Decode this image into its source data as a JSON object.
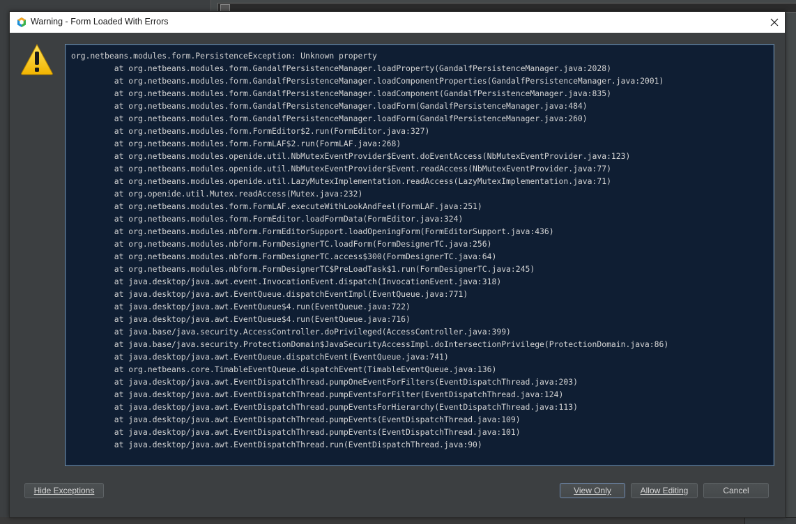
{
  "dialog": {
    "title": "Warning - Form Loaded With Errors"
  },
  "trace": {
    "lines": [
      "org.netbeans.modules.form.PersistenceException: Unknown property",
      "\tat org.netbeans.modules.form.GandalfPersistenceManager.loadProperty(GandalfPersistenceManager.java:2028)",
      "\tat org.netbeans.modules.form.GandalfPersistenceManager.loadComponentProperties(GandalfPersistenceManager.java:2001)",
      "\tat org.netbeans.modules.form.GandalfPersistenceManager.loadComponent(GandalfPersistenceManager.java:835)",
      "\tat org.netbeans.modules.form.GandalfPersistenceManager.loadForm(GandalfPersistenceManager.java:484)",
      "\tat org.netbeans.modules.form.GandalfPersistenceManager.loadForm(GandalfPersistenceManager.java:260)",
      "\tat org.netbeans.modules.form.FormEditor$2.run(FormEditor.java:327)",
      "\tat org.netbeans.modules.form.FormLAF$2.run(FormLAF.java:268)",
      "\tat org.netbeans.modules.openide.util.NbMutexEventProvider$Event.doEventAccess(NbMutexEventProvider.java:123)",
      "\tat org.netbeans.modules.openide.util.NbMutexEventProvider$Event.readAccess(NbMutexEventProvider.java:77)",
      "\tat org.netbeans.modules.openide.util.LazyMutexImplementation.readAccess(LazyMutexImplementation.java:71)",
      "\tat org.openide.util.Mutex.readAccess(Mutex.java:232)",
      "\tat org.netbeans.modules.form.FormLAF.executeWithLookAndFeel(FormLAF.java:251)",
      "\tat org.netbeans.modules.form.FormEditor.loadFormData(FormEditor.java:324)",
      "\tat org.netbeans.modules.nbform.FormEditorSupport.loadOpeningForm(FormEditorSupport.java:436)",
      "\tat org.netbeans.modules.nbform.FormDesignerTC.loadForm(FormDesignerTC.java:256)",
      "\tat org.netbeans.modules.nbform.FormDesignerTC.access$300(FormDesignerTC.java:64)",
      "\tat org.netbeans.modules.nbform.FormDesignerTC$PreLoadTask$1.run(FormDesignerTC.java:245)",
      "\tat java.desktop/java.awt.event.InvocationEvent.dispatch(InvocationEvent.java:318)",
      "\tat java.desktop/java.awt.EventQueue.dispatchEventImpl(EventQueue.java:771)",
      "\tat java.desktop/java.awt.EventQueue$4.run(EventQueue.java:722)",
      "\tat java.desktop/java.awt.EventQueue$4.run(EventQueue.java:716)",
      "\tat java.base/java.security.AccessController.doPrivileged(AccessController.java:399)",
      "\tat java.base/java.security.ProtectionDomain$JavaSecurityAccessImpl.doIntersectionPrivilege(ProtectionDomain.java:86)",
      "\tat java.desktop/java.awt.EventQueue.dispatchEvent(EventQueue.java:741)",
      "\tat org.netbeans.core.TimableEventQueue.dispatchEvent(TimableEventQueue.java:136)",
      "\tat java.desktop/java.awt.EventDispatchThread.pumpOneEventForFilters(EventDispatchThread.java:203)",
      "\tat java.desktop/java.awt.EventDispatchThread.pumpEventsForFilter(EventDispatchThread.java:124)",
      "\tat java.desktop/java.awt.EventDispatchThread.pumpEventsForHierarchy(EventDispatchThread.java:113)",
      "\tat java.desktop/java.awt.EventDispatchThread.pumpEvents(EventDispatchThread.java:109)",
      "\tat java.desktop/java.awt.EventDispatchThread.pumpEvents(EventDispatchThread.java:101)",
      "\tat java.desktop/java.awt.EventDispatchThread.run(EventDispatchThread.java:90)"
    ]
  },
  "buttons": {
    "hide_exceptions": "Hide Exceptions",
    "view_only": "View Only",
    "allow_editing": "Allow Editing",
    "cancel": "Cancel"
  },
  "icons": {
    "app": "netbeans-logo-icon",
    "warning": "warning-icon",
    "close": "close-icon"
  },
  "colors": {
    "trace_background": "#0f1e33",
    "trace_text": "#d4d4d4",
    "dialog_background": "#3c3f41",
    "warning_yellow": "#f5c800"
  }
}
